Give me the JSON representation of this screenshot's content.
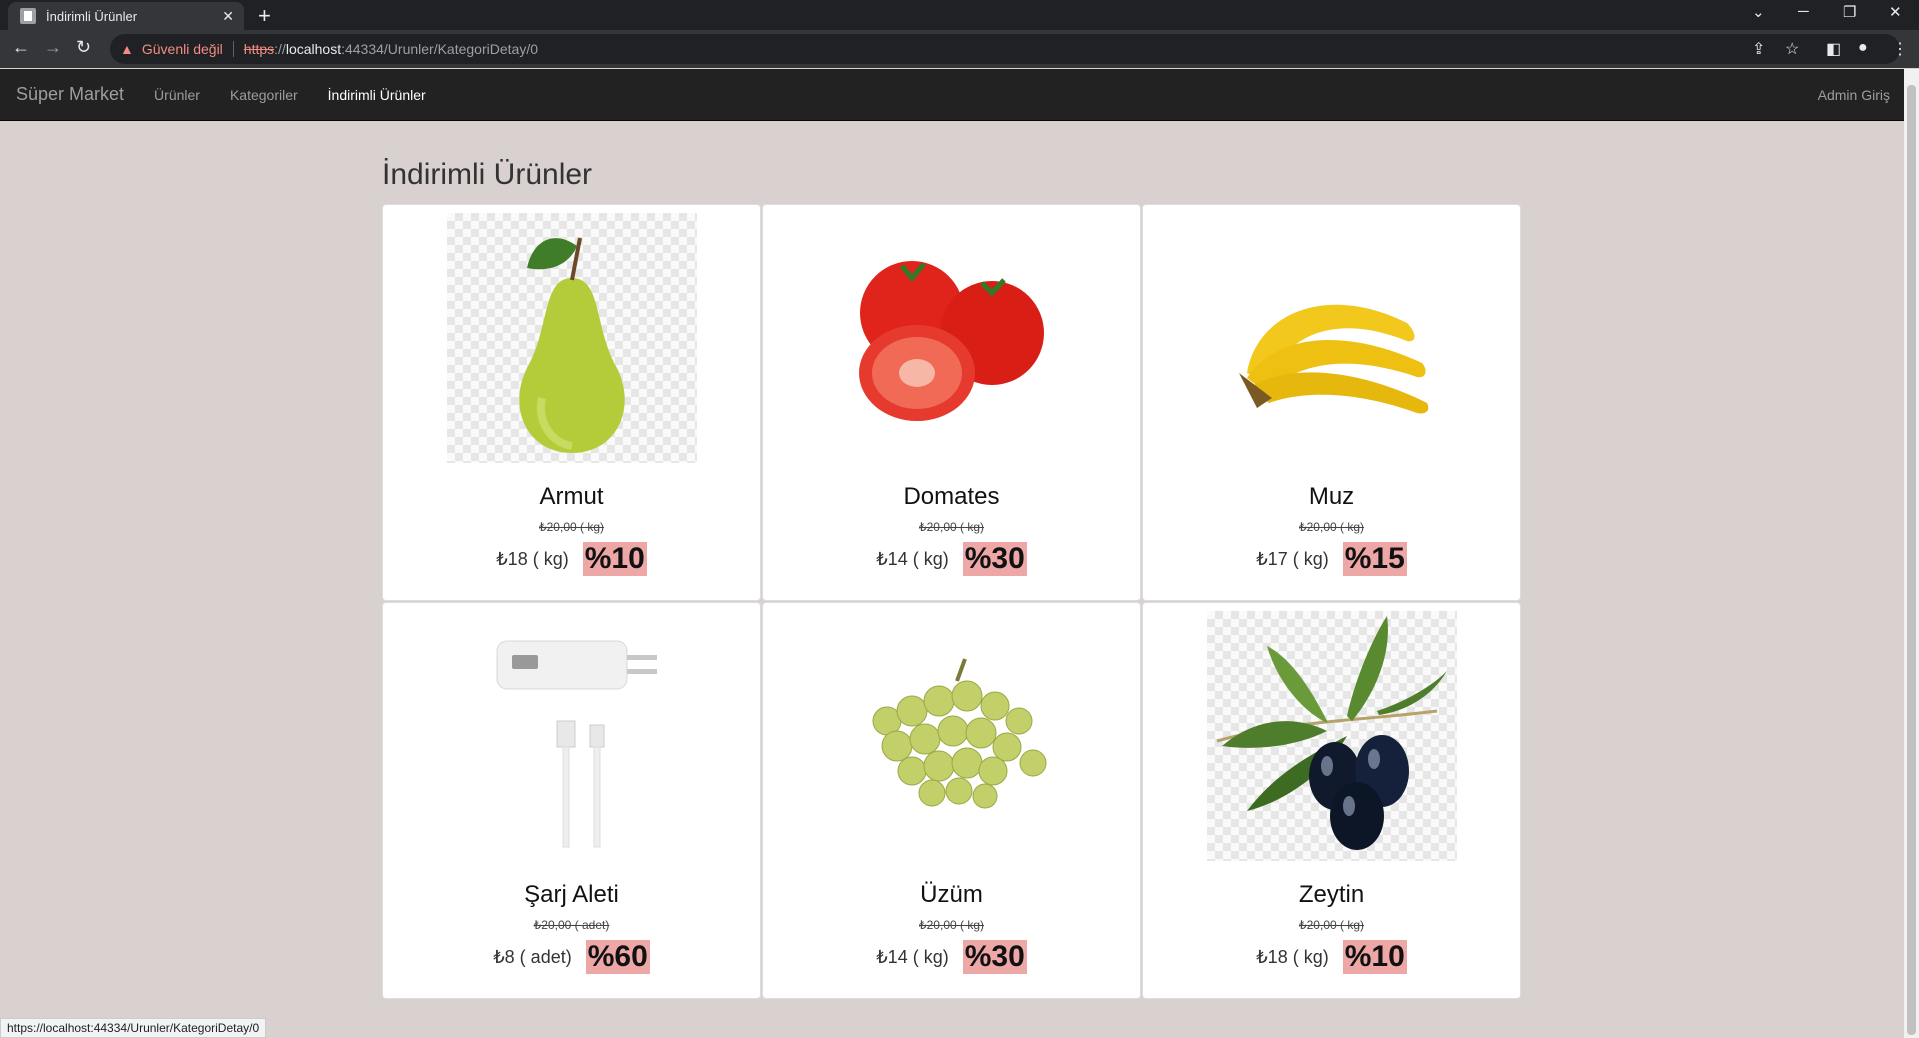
{
  "browser": {
    "tab_title": "İndirimli Ürünler",
    "security_label": "Güvenli değil",
    "url_scheme": "https",
    "url_sep": "://",
    "url_host": "localhost",
    "url_path": ":44334/Urunler/KategoriDetay/0",
    "status_url": "https://localhost:44334/Urunler/KategoriDetay/0"
  },
  "nav": {
    "brand": "Süper Market",
    "links": [
      "Ürünler",
      "Kategoriler",
      "İndirimli Ürünler"
    ],
    "active": "İndirimli Ürünler",
    "admin": "Admin Giriş"
  },
  "page": {
    "title": "İndirimli Ürünler"
  },
  "products": [
    {
      "name": "Armut",
      "old_price": "₺20,00 ( kg)",
      "new_price": "₺18 ( kg)",
      "discount": "%10",
      "image_icon": "pear-icon"
    },
    {
      "name": "Domates",
      "old_price": "₺20,00 ( kg)",
      "new_price": "₺14 ( kg)",
      "discount": "%30",
      "image_icon": "tomato-icon"
    },
    {
      "name": "Muz",
      "old_price": "₺20,00 ( kg)",
      "new_price": "₺17 ( kg)",
      "discount": "%15",
      "image_icon": "banana-icon"
    },
    {
      "name": "Şarj Aleti",
      "old_price": "₺20,00 ( adet)",
      "new_price": "₺8 ( adet)",
      "discount": "%60",
      "image_icon": "charger-icon"
    },
    {
      "name": "Üzüm",
      "old_price": "₺20,00 ( kg)",
      "new_price": "₺14 ( kg)",
      "discount": "%30",
      "image_icon": "grapes-icon"
    },
    {
      "name": "Zeytin",
      "old_price": "₺20,00 ( kg)",
      "new_price": "₺18 ( kg)",
      "discount": "%10",
      "image_icon": "olive-icon"
    }
  ],
  "colors": {
    "page_bg": "#d9d0d0",
    "navbar_bg": "#222222",
    "badge_bg": "#eea7a7"
  }
}
